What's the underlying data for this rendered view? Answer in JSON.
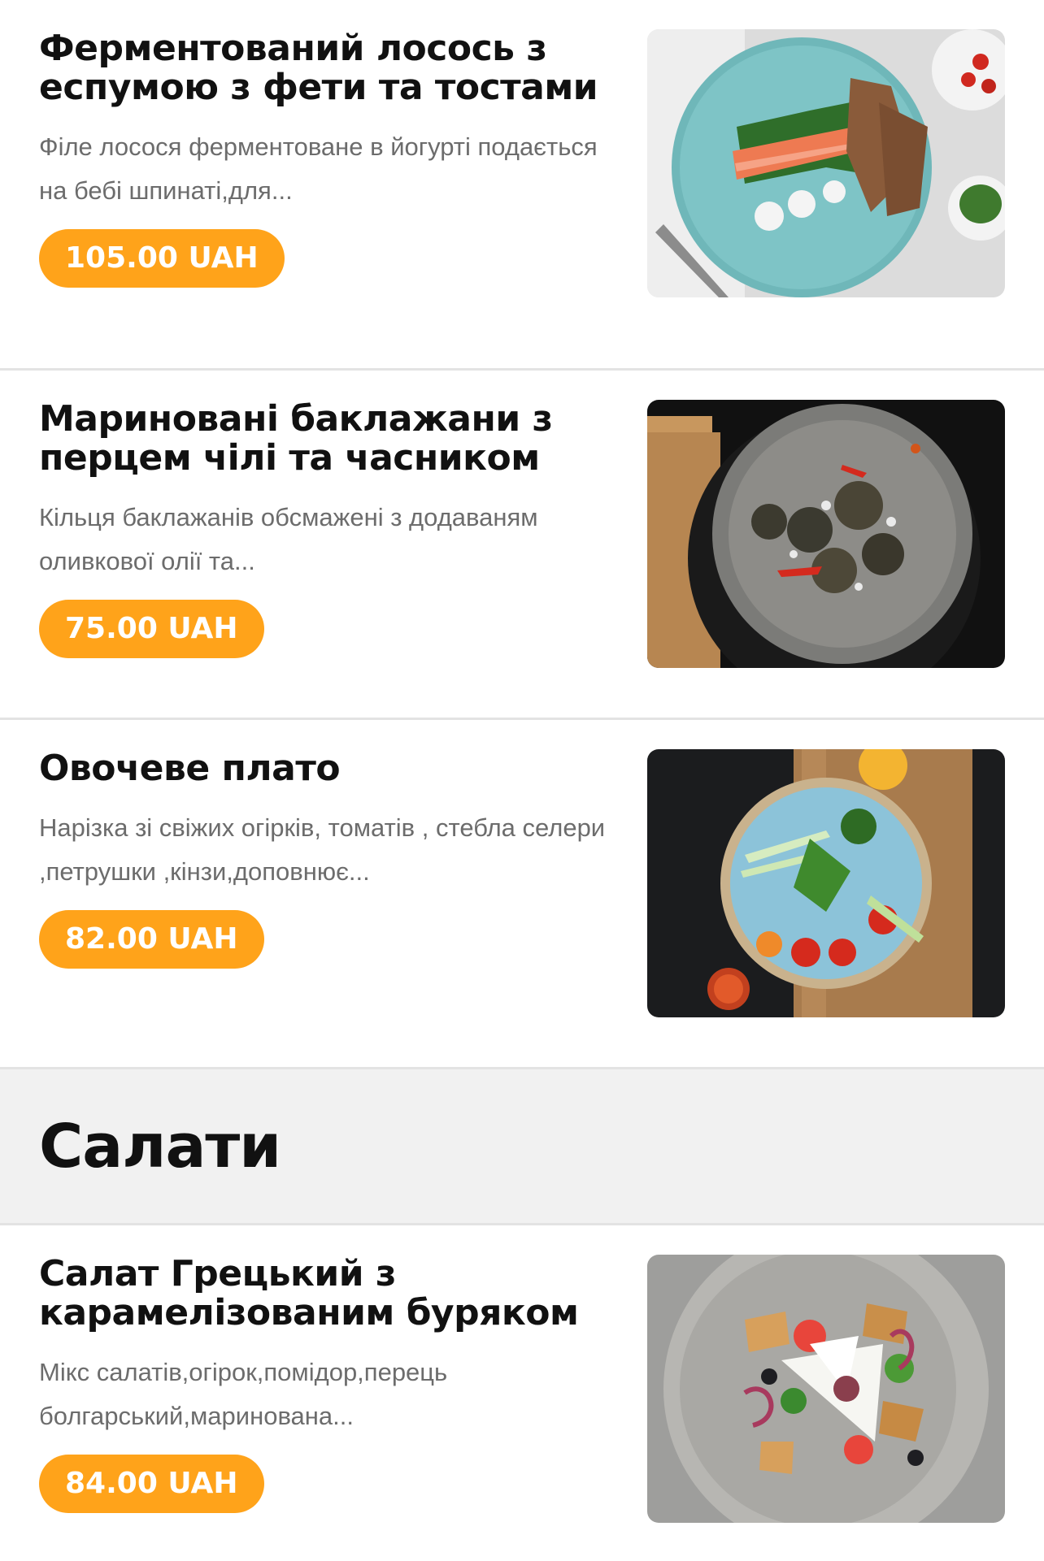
{
  "items_top": [
    {
      "title": "Ферментований лосось з еспумою з фети та тостами",
      "description": "Філе лосося ферментоване в йогурті подається на бебі шпинаті,для...",
      "price": "105.00 UAH",
      "photo_icon": "salmon-plate-photo"
    },
    {
      "title": "Мариновані баклажани з перцем чілі та часником",
      "description": "Кільця баклажанів обсмажені з додаваням оливкової олії та...",
      "price": "75.00 UAH",
      "photo_icon": "eggplant-bowl-photo"
    },
    {
      "title": "Овочеве плато",
      "description": "Нарізка зі свіжих огірків, томатів , стебла селери ,петрушки ,кінзи,доповнює...",
      "price": "82.00 UAH",
      "photo_icon": "vegetable-plate-photo"
    }
  ],
  "section": {
    "title": "Салати"
  },
  "items_bottom": [
    {
      "title": "Салат Грецький з карамелізованим буряком",
      "description": "Мікс салатів,огірок,помідор,перець болгарський,маринована...",
      "price": "84.00 UAH",
      "photo_icon": "greek-salad-photo"
    }
  ],
  "colors": {
    "price_badge": "#ffa31a",
    "section_background": "#f1f1f1",
    "divider": "#e3e3e3"
  }
}
